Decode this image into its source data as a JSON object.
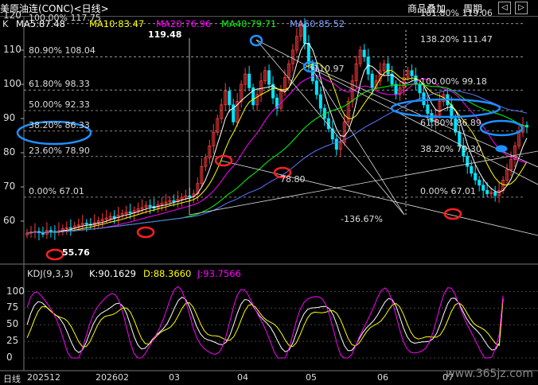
{
  "header": {
    "title": "美原油连(CONC)<日线>",
    "menu_overlay": "商品叠加",
    "menu_period": "周期",
    "btn_prev": "◁",
    "btn_next": "▷"
  },
  "main_legend": {
    "prefix": "K",
    "ma5": "MA5:87.48",
    "ma10": "MA10:83.47",
    "ma20": "MA20:76.96",
    "ma40": "MA40:79.71",
    "ma60": "MA60:85.52"
  },
  "kdj_legend": {
    "name": "KDJ(9,3,3)",
    "k": "K:90.1629",
    "d": "D:88.3660",
    "j": "J:93.7566"
  },
  "annotations": {
    "peak": "119.48",
    "low": "55.76",
    "peak2_label": "110.97",
    "low2_label": "78.80",
    "neg_ext": "-136.67%"
  },
  "fib_left": [
    {
      "pct": "100.00%",
      "val": "117.75",
      "price": 117.75
    },
    {
      "pct": "80.90%",
      "val": "108.04",
      "price": 108.04
    },
    {
      "pct": "61.80%",
      "val": "98.33",
      "price": 98.33
    },
    {
      "pct": "50.00%",
      "val": "92.33",
      "price": 92.33
    },
    {
      "pct": "38.20%",
      "val": "86.33",
      "price": 86.33
    },
    {
      "pct": "23.60%",
      "val": "78.90",
      "price": 78.9
    },
    {
      "pct": "0.00%",
      "val": "67.01",
      "price": 67.01
    }
  ],
  "fib_right": [
    {
      "pct": "161.80%",
      "val": "119.06",
      "price": 119.06
    },
    {
      "pct": "138.20%",
      "val": "111.47",
      "price": 111.47
    },
    {
      "pct": "100.00%",
      "val": "99.18",
      "price": 99.18
    },
    {
      "pct": "61.80%",
      "val": "86.89",
      "price": 86.89
    },
    {
      "pct": "38.20%",
      "val": "79.30",
      "price": 79.3
    },
    {
      "pct": "0.00%",
      "val": "67.01",
      "price": 67.01
    }
  ],
  "watermark": "www.365jz.com",
  "chart_data": [
    {
      "type": "candlestick",
      "title": "美原油连(CONC)<日线>",
      "ylim": [
        52,
        126
      ],
      "y_ticks": [
        60,
        70,
        80,
        90,
        100,
        110,
        120
      ],
      "x_ticks": [
        "日线",
        "202512",
        "202602",
        "03",
        "04",
        "05",
        "06",
        "07"
      ],
      "series": [
        {
          "name": "MA5",
          "value": 87.48,
          "color": "#ffffff"
        },
        {
          "name": "MA10",
          "value": 83.47,
          "color": "#ffff00"
        },
        {
          "name": "MA20",
          "value": 76.96,
          "color": "#ff00ff"
        },
        {
          "name": "MA40",
          "value": 79.71,
          "color": "#00ff00"
        },
        {
          "name": "MA60",
          "value": 85.52,
          "color": "#5a78ff"
        }
      ],
      "close": [
        56.5,
        56.8,
        57.0,
        56.6,
        56.2,
        57.3,
        57.0,
        56.7,
        57.2,
        57.8,
        58.1,
        57.9,
        58.6,
        58.9,
        59.4,
        59.1,
        58.8,
        59.6,
        60.1,
        60.5,
        60.9,
        61.4,
        61.0,
        61.8,
        62.2,
        62.7,
        62.4,
        63.1,
        63.6,
        64.0,
        64.6,
        64.3,
        63.8,
        64.8,
        65.2,
        65.6,
        66.0,
        65.7,
        66.4,
        67.0,
        67.4,
        67.1,
        68.0,
        71.0,
        76.0,
        78.5,
        82.0,
        86.0,
        90.0,
        94.0,
        98.0,
        94.0,
        89.0,
        95.0,
        100.0,
        103.0,
        99.0,
        94.0,
        97.0,
        101.0,
        104.0,
        100.0,
        96.0,
        93.0,
        98.0,
        102.0,
        106.0,
        110.0,
        114.0,
        117.5,
        112.0,
        106.0,
        101.0,
        97.0,
        93.0,
        90.0,
        87.0,
        84.0,
        81.0,
        83.0,
        89.0,
        95.0,
        101.0,
        106.0,
        110.0,
        108.0,
        103.0,
        99.0,
        101.0,
        104.0,
        106.0,
        103.0,
        100.0,
        97.0,
        99.0,
        102.0,
        104.0,
        102.5,
        100.0,
        97.5,
        94.0,
        91.5,
        89.0,
        91.0,
        95.0,
        97.0,
        94.0,
        90.0,
        86.0,
        82.0,
        79.0,
        76.0,
        74.0,
        72.0,
        70.5,
        69.0,
        68.0,
        68.5,
        67.5,
        69.0,
        72.0,
        75.0,
        78.0,
        82.0,
        86.0,
        88.0,
        87.5
      ]
    },
    {
      "type": "line",
      "title": "KDJ(9,3,3)",
      "ylim": [
        0,
        115
      ],
      "y_ticks": [
        0,
        25,
        50,
        75,
        100
      ],
      "y_tick_labels": [
        "0",
        "25",
        "50",
        "75",
        "100"
      ],
      "series": [
        {
          "name": "K",
          "value": 90.1629,
          "color": "#ffffff"
        },
        {
          "name": "D",
          "value": 88.366,
          "color": "#ffff00"
        },
        {
          "name": "J",
          "value": 93.7566,
          "color": "#ff00ff"
        }
      ]
    }
  ]
}
